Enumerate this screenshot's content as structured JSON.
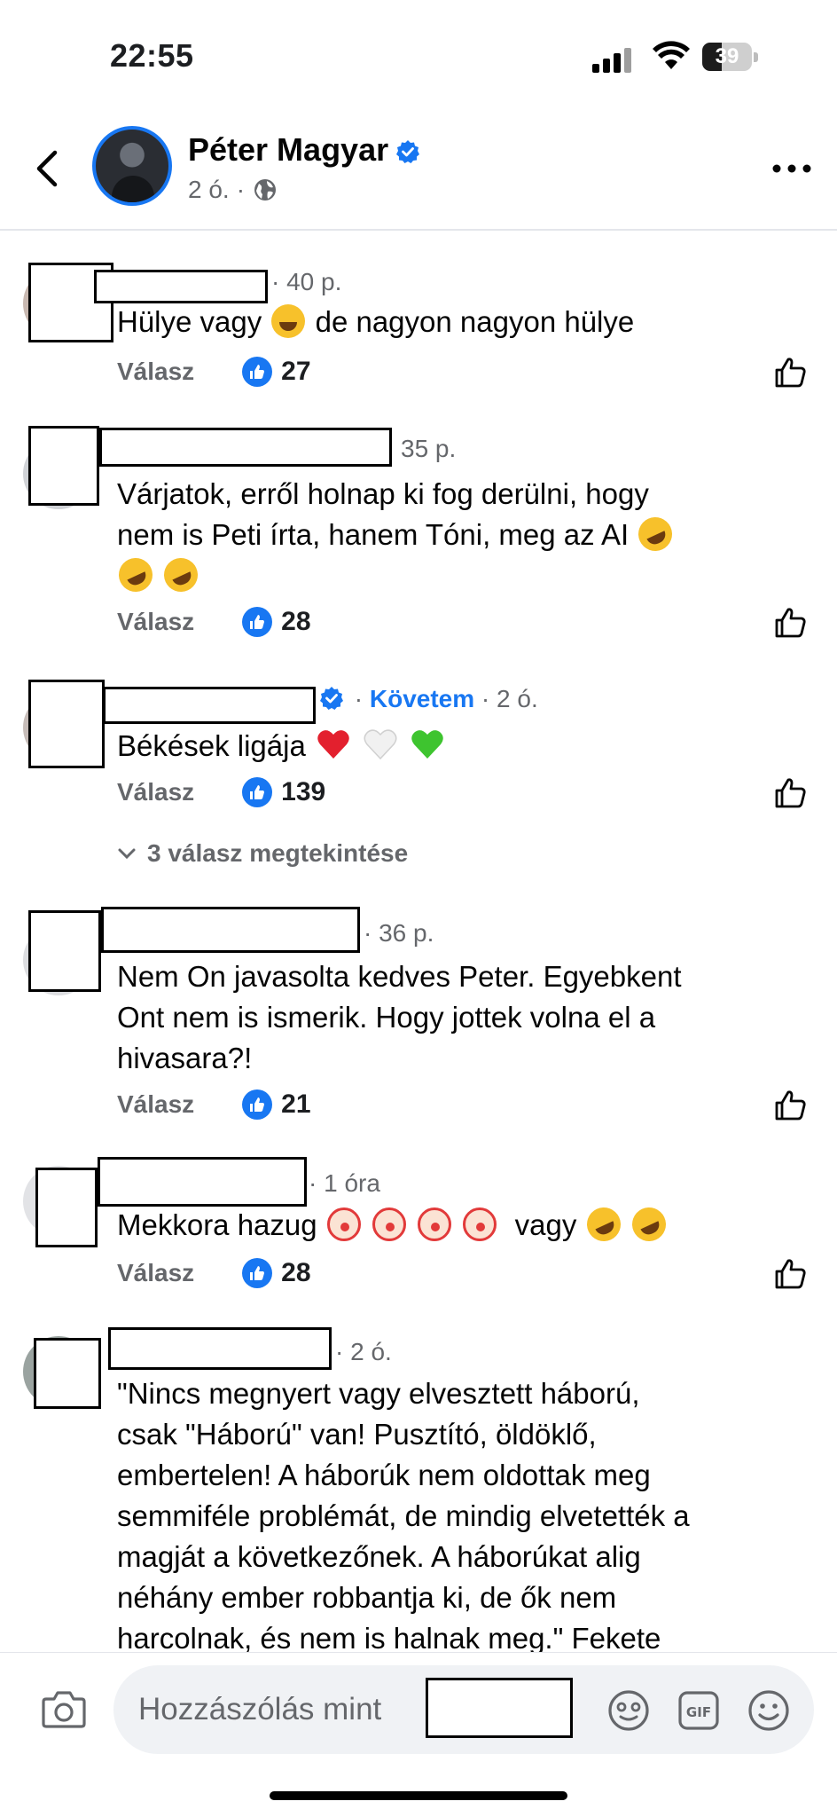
{
  "status_bar": {
    "time": "22:55",
    "battery": "39"
  },
  "header": {
    "name": "Péter Magyar",
    "time": "2 ó."
  },
  "reply_label": "Válasz",
  "comments": [
    {
      "time": "40 p.",
      "text_1": "Hülye vagy",
      "text_2": "de nagyon nagyon hülye",
      "likes": "27"
    },
    {
      "time": "35 p.",
      "text_1": "Várjatok, erről holnap ki fog derülni, hogy",
      "text_2": "nem is Peti írta, hanem Tóni, meg az AI",
      "likes": "28"
    },
    {
      "follow": "Követem",
      "time": "2 ó.",
      "text_1": "Békések ligája",
      "likes": "139"
    },
    {
      "time": "36 p.",
      "text_1": "Nem On javasolta  kedves Peter. Egyebkent",
      "text_2": "Ont nem is ismerik. Hogy jottek volna el a",
      "text_3": "hivasara?!",
      "likes": "21"
    },
    {
      "time": "1 óra",
      "text_1": "Mekkora hazug",
      "text_2": "vagy",
      "likes": "28"
    },
    {
      "time": "2 ó.",
      "text_1": "\"Nincs megnyert vagy elvesztett háború,",
      "text_2": "csak \"Háború\" van! Pusztító, öldöklő,",
      "text_3": "embertelen! A háborúk nem oldottak meg",
      "text_4": "semmiféle problémát, de mindig elvetették a",
      "text_5": "magját a következőnek. A háborúkat alig",
      "text_6": "néhány ember robbantja ki, de ők nem",
      "text_7": "harcolnak, és nem is halnak meg.\" Fekete"
    }
  ],
  "view_replies": "3 válasz megtekintése",
  "composer": {
    "placeholder": "Hozzászólás mint"
  },
  "colors": {
    "accent": "#1877f2",
    "secondary_text": "#65676b"
  }
}
